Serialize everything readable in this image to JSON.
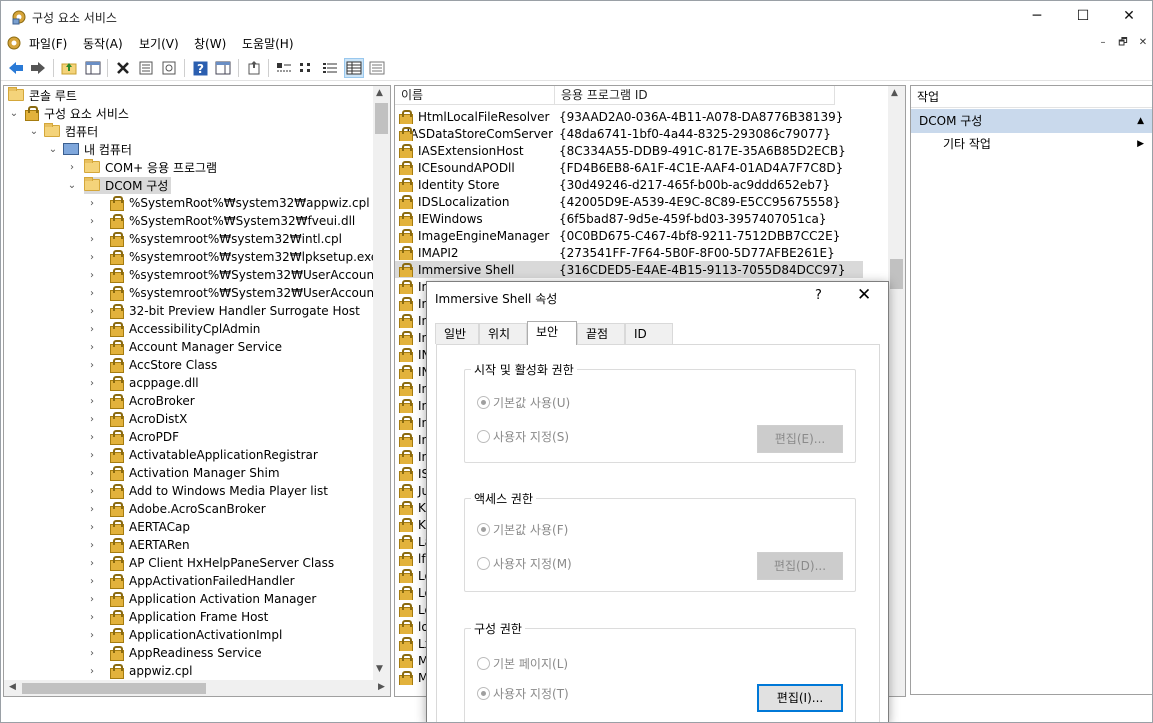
{
  "window": {
    "title": "구성 요소 서비스",
    "controls": {
      "minimize": "─",
      "maximize": "☐",
      "close": "✕"
    }
  },
  "menu": {
    "items": [
      "파일(F)",
      "동작(A)",
      "보기(V)",
      "창(W)",
      "도움말(H)"
    ],
    "mdi_controls": {
      "minimize": "–",
      "restore": "🗗",
      "close": "✕"
    }
  },
  "toolbar": {
    "buttons": [
      "back-icon",
      "forward-icon",
      "up-folder-icon",
      "show-hide-tree-icon",
      "delete-icon",
      "properties-icon",
      "refresh-icon",
      "help-icon",
      "show-hide-action-pane-icon",
      "export-list-icon",
      "large-icons-view-icon",
      "small-icons-view-icon",
      "list-view-icon",
      "detail-view-icon",
      "status-view-icon"
    ]
  },
  "tree": {
    "root": "콘솔 루트",
    "component_services": "구성 요소 서비스",
    "computers": "컴퓨터",
    "my_computer": "내 컴퓨터",
    "com_plus": "COM+ 응용 프로그램",
    "dcom": "DCOM 구성",
    "items": [
      "%SystemRoot%₩system32₩appwiz.cpl",
      "%SystemRoot%₩System32₩fveui.dll",
      "%systemroot%₩system32₩intl.cpl",
      "%systemroot%₩system32₩lpksetup.exe",
      "%systemroot%₩System32₩UserAccountContr",
      "%systemroot%₩System32₩UserAccountContr",
      "32-bit Preview Handler Surrogate Host",
      "AccessibilityCplAdmin",
      "Account Manager Service",
      "AccStore Class",
      "acppage.dll",
      "AcroBroker",
      "AcroDistX",
      "AcroPDF",
      "ActivatableApplicationRegistrar",
      "Activation Manager Shim",
      "Add to Windows Media Player list",
      "Adobe.AcroScanBroker",
      "AERTACap",
      "AERTARen",
      "AP Client HxHelpPaneServer Class",
      "AppActivationFailedHandler",
      "Application Activation Manager",
      "Application Frame Host",
      "ApplicationActivationImpl",
      "AppReadiness Service",
      "appwiz.cpl"
    ]
  },
  "list": {
    "columns": {
      "name": "이름",
      "appid": "응용 프로그램 ID"
    },
    "rows": [
      {
        "name": "HtmlLocalFileResolver",
        "id": "{93AAD2A0-036A-4B11-A078-DA8776B38139}"
      },
      {
        "name": "IASDataStoreComServer",
        "id": "{48da6741-1bf0-4a44-8325-293086c79077}"
      },
      {
        "name": "IASExtensionHost",
        "id": "{8C334A55-DDB9-491C-817E-35A6B85D2ECB}"
      },
      {
        "name": "ICEsoundAPODll",
        "id": "{FD4B6EB8-6A1F-4C1E-AAF4-01AD4A7F7C8D}"
      },
      {
        "name": "Identity Store",
        "id": "{30d49246-d217-465f-b00b-ac9ddd652eb7}"
      },
      {
        "name": "IDSLocalization",
        "id": "{42005D9E-A539-4E9C-8C89-E5CC95675558}"
      },
      {
        "name": "IEWindows",
        "id": "{6f5bad87-9d5e-459f-bd03-3957407051ca}"
      },
      {
        "name": "ImageEngineManager",
        "id": "{0C0BD675-C467-4bf8-9211-7512DBB7CC2E}"
      },
      {
        "name": "IMAPI2",
        "id": "{273541FF-7F64-5B0F-8F00-5D77AFBE261E}"
      },
      {
        "name": "Immersive Shell",
        "id": "{316CDED5-E4AE-4B15-9113-7055D84DCC97}"
      }
    ],
    "partial": [
      "Im",
      "Im",
      "In",
      "In",
      "IN",
      "IN",
      "In",
      "In",
      "In",
      "In",
      "In",
      "IS",
      "Ju",
      "Ki",
      "Kr",
      "La",
      "lfs",
      "Lo",
      "Lo",
      "Lo",
      "lo",
      "Lx",
      "M",
      "M"
    ]
  },
  "actions": {
    "header": "작업",
    "section": "DCOM 구성",
    "item": "기타 작업"
  },
  "dialog": {
    "title": "Immersive Shell 속성",
    "help": "?",
    "close": "✕",
    "tabs": [
      "일반",
      "위치",
      "보안",
      "끝점",
      "ID"
    ],
    "groups": [
      {
        "label": "시작 및 활성화 권한",
        "opt1": "기본값 사용(U)",
        "opt2": "사용자 지정(S)",
        "button": "편집(E)..."
      },
      {
        "label": "액세스 권한",
        "opt1": "기본값 사용(F)",
        "opt2": "사용자 지정(M)",
        "button": "편집(D)..."
      },
      {
        "label": "구성 권한",
        "opt1": "기본 페이지(L)",
        "opt2": "사용자 지정(T)",
        "button": "편집(I)..."
      }
    ]
  }
}
